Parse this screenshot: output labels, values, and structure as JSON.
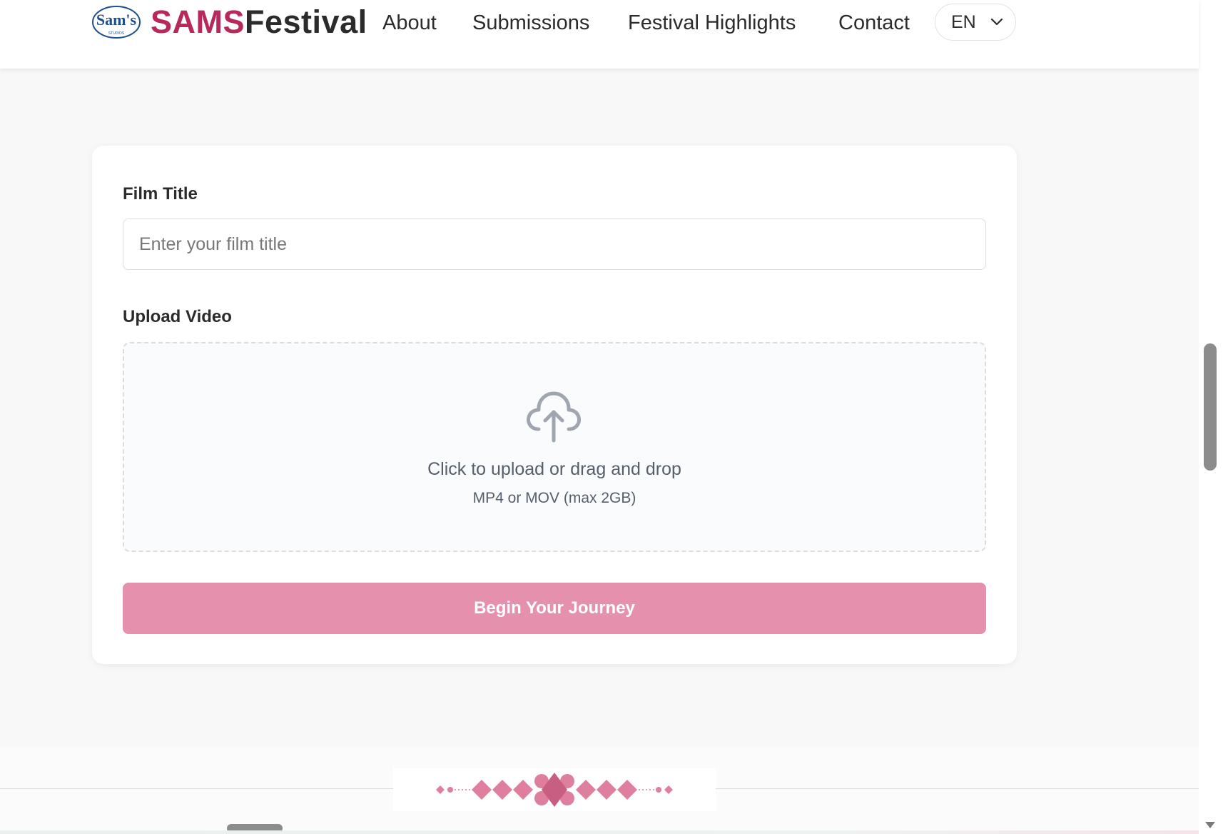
{
  "header": {
    "brand_part1": "SAMS",
    "brand_part2": "Festival",
    "logo_text": "Sam's",
    "logo_subtext": "STUDIOS",
    "nav": [
      "About",
      "Submissions",
      "Festival Highlights",
      "Contact"
    ],
    "language": "EN"
  },
  "form": {
    "film_title_label": "Film Title",
    "film_title_placeholder": "Enter your film title",
    "film_title_value": "",
    "upload_label": "Upload Video",
    "upload_main_text": "Click to upload or drag and drop",
    "upload_sub_text": "MP4 or MOV (max 2GB)",
    "submit_label": "Begin Your Journey"
  },
  "colors": {
    "brand_primary": "#b8285a",
    "brand_secondary": "#8b3a66",
    "button": "#e591ae",
    "ornament": "#dd7f9d"
  },
  "icons": {
    "upload": "cloud-upload-icon",
    "language_chevron": "chevron-down-icon"
  }
}
